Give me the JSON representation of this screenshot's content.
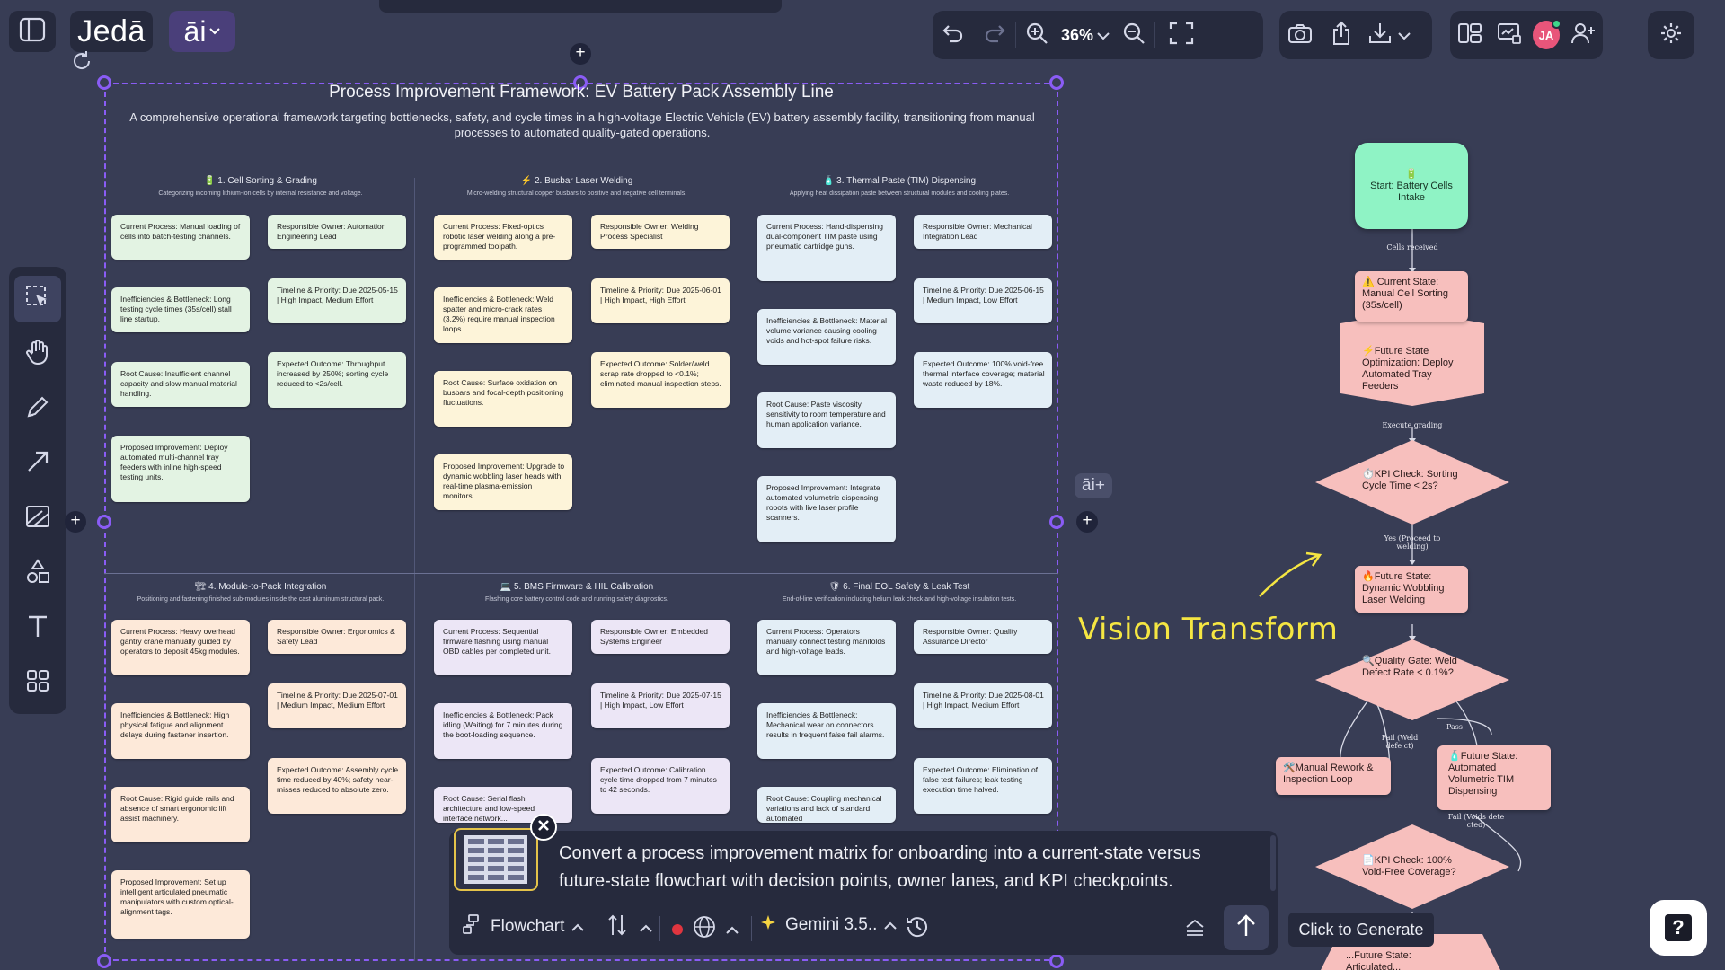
{
  "app": {
    "logo": "Jedā",
    "ai_badge": "āi",
    "zoom_level": "36%"
  },
  "user": {
    "initials": "JA",
    "avatar_color": "#e8557a",
    "status_color": "#3ed68a"
  },
  "colors": {
    "accent": "#8a5cf5",
    "canvas_bg": "#383d55",
    "panel_bg": "#262a3d",
    "annotation": "#f5e642"
  },
  "icons": {
    "top_left": [
      "sidebar-toggle-icon",
      "chevron-down-icon"
    ],
    "top_right": [
      "undo-icon",
      "redo-icon",
      "zoom-in-icon",
      "zoom-out-icon",
      "fit-screen-icon",
      "camera-icon",
      "upload-icon",
      "download-icon",
      "layout-icon",
      "presentation-icon",
      "add-user-icon",
      "settings-icon"
    ],
    "left_toolbar": [
      "select-icon",
      "hand-icon",
      "pencil-icon",
      "arrow-icon",
      "image-icon",
      "shapes-icon",
      "text-icon",
      "grid-icon"
    ]
  },
  "document": {
    "title": "Process Improvement Framework: EV Battery Pack Assembly Line",
    "subtitle": "A comprehensive operational framework targeting bottlenecks, safety, and cycle times in a high-voltage Electric Vehicle (EV) battery assembly facility, transitioning from manual processes to automated quality-gated operations.",
    "sections": [
      {
        "title": "🔋 1. Cell Sorting & Grading",
        "sub": "Categorizing incoming lithium-ion cells by internal resistance and voltage.",
        "left": [
          "Current Process: Manual loading of cells into batch-testing channels.",
          "Inefficiencies & Bottleneck: Long testing cycle times (35s/cell) stall line startup.",
          "Root Cause: Insufficient channel capacity and slow manual material handling.",
          "Proposed Improvement: Deploy automated multi-channel tray feeders with inline high-speed testing units."
        ],
        "right": [
          "Responsible Owner: Automation Engineering Lead",
          "Timeline & Priority: Due 2025-05-15 | High Impact, Medium Effort",
          "Expected Outcome: Throughput increased by 250%; sorting cycle reduced to <2s/cell."
        ]
      },
      {
        "title": "⚡ 2. Busbar Laser Welding",
        "sub": "Micro-welding structural copper busbars to positive and negative cell terminals.",
        "left": [
          "Current Process: Fixed-optics robotic laser welding along a pre-programmed toolpath.",
          "Inefficiencies & Bottleneck: Weld spatter and micro-crack rates (3.2%) require manual inspection loops.",
          "Root Cause: Surface oxidation on busbars and focal-depth positioning fluctuations.",
          "Proposed Improvement: Upgrade to dynamic wobbling laser heads with real-time plasma-emission monitors."
        ],
        "right": [
          "Responsible Owner: Welding Process Specialist",
          "Timeline & Priority: Due 2025-06-01 | High Impact, High Effort",
          "Expected Outcome: Solder/weld scrap rate dropped to <0.1%; eliminated manual inspection steps."
        ]
      },
      {
        "title": "🧴 3. Thermal Paste (TIM) Dispensing",
        "sub": "Applying heat dissipation paste between structural modules and cooling plates.",
        "left": [
          "Current Process: Hand-dispensing dual-component TIM paste using pneumatic cartridge guns.",
          "Inefficiencies & Bottleneck: Material volume variance causing cooling voids and hot-spot failure risks.",
          "Root Cause: Paste viscosity sensitivity to room temperature and human application variance.",
          "Proposed Improvement: Integrate automated volumetric dispensing robots with live laser profile scanners."
        ],
        "right": [
          "Responsible Owner: Mechanical Integration Lead",
          "Timeline & Priority: Due 2025-06-15 | Medium Impact, Low Effort",
          "Expected Outcome: 100% void-free thermal interface coverage; material waste reduced by 18%."
        ]
      },
      {
        "title": "🏗 4. Module-to-Pack Integration",
        "sub": "Positioning and fastening finished sub-modules inside the cast aluminum structural pack.",
        "left": [
          "Current Process: Heavy overhead gantry crane manually guided by operators to deposit 45kg modules.",
          "Inefficiencies & Bottleneck: High physical fatigue and alignment delays during fastener insertion.",
          "Root Cause: Rigid guide rails and absence of smart ergonomic lift assist machinery.",
          "Proposed Improvement: Set up intelligent articulated pneumatic manipulators with custom optical-alignment tags."
        ],
        "right": [
          "Responsible Owner: Ergonomics & Safety Lead",
          "Timeline & Priority: Due 2025-07-01 | Medium Impact, Medium Effort",
          "Expected Outcome: Assembly cycle time reduced by 40%; safety near-misses reduced to absolute zero."
        ]
      },
      {
        "title": "💻 5. BMS Firmware & HIL Calibration",
        "sub": "Flashing core battery control code and running safety diagnostics.",
        "left": [
          "Current Process: Sequential firmware flashing using manual OBD cables per completed unit.",
          "Inefficiencies & Bottleneck: Pack idling (Waiting) for 7 minutes during the boot-loading sequence.",
          "Root Cause: Serial flash architecture and low-speed interface network..."
        ],
        "right": [
          "Responsible Owner: Embedded Systems Engineer",
          "Timeline & Priority: Due 2025-07-15 | High Impact, Low Effort",
          "Expected Outcome: Calibration cycle time dropped from 7 minutes to 42 seconds."
        ]
      },
      {
        "title": "🛡 6. Final EOL Safety & Leak Test",
        "sub": "End-of-line verification including helium leak check and high-voltage insulation tests.",
        "left": [
          "Current Process: Operators manually connect testing manifolds and high-voltage leads.",
          "Inefficiencies & Bottleneck: Mechanical wear on connectors results in frequent false fail alarms.",
          "Root Cause: Coupling mechanical variations and lack of standard automated"
        ],
        "right": [
          "Responsible Owner: Quality Assurance Director",
          "Timeline & Priority: Due 2025-08-01 | High Impact, Medium Effort",
          "Expected Outcome: Elimination of false test failures; leak testing execution time halved."
        ]
      }
    ]
  },
  "flowchart": {
    "start": "Start: Battery Cells Intake",
    "start_icon": "🔋",
    "edge_cells_received": "Cells received",
    "current_state": "⚠️ Current State: Manual Cell Sorting (35s/cell)",
    "optimization": "⚡Future State Optimization: Deploy Automated Tray Feeders",
    "edge_execute_grading": "Execute grading",
    "kpi_sorting": "⏱️KPI Check: Sorting Cycle Time < 2s?",
    "edge_yes": "Yes (Proceed to welding)",
    "future_welding": "🔥Future State: Dynamic Wobbling Laser Welding",
    "quality_gate": "🔍Quality Gate: Weld Defect Rate < 0.1%?",
    "edge_fail": "Fail (Weld defe ct)",
    "edge_pass": "Pass",
    "rework": "🛠️Manual Rework & Inspection Loop",
    "future_tim": "🧴Future State: Automated Volumetric TIM Dispensing",
    "edge_fail_voids": "Fail (Voids dete cted)",
    "kpi_void": "📄KPI Check: 100% Void-Free Coverage?",
    "future_bottom": "...Future State: Articulated..."
  },
  "annotation": {
    "text": "Vision Transform"
  },
  "side_label": "āi+",
  "prompt": {
    "text": "Convert a process improvement matrix for onboarding into a current-state versus future-state flowchart with decision points, owner lanes, and KPI checkpoints.",
    "mode": "Flowchart",
    "model": "Gemini 3.5..",
    "generate_hint": "Click to Generate",
    "help": "?"
  }
}
